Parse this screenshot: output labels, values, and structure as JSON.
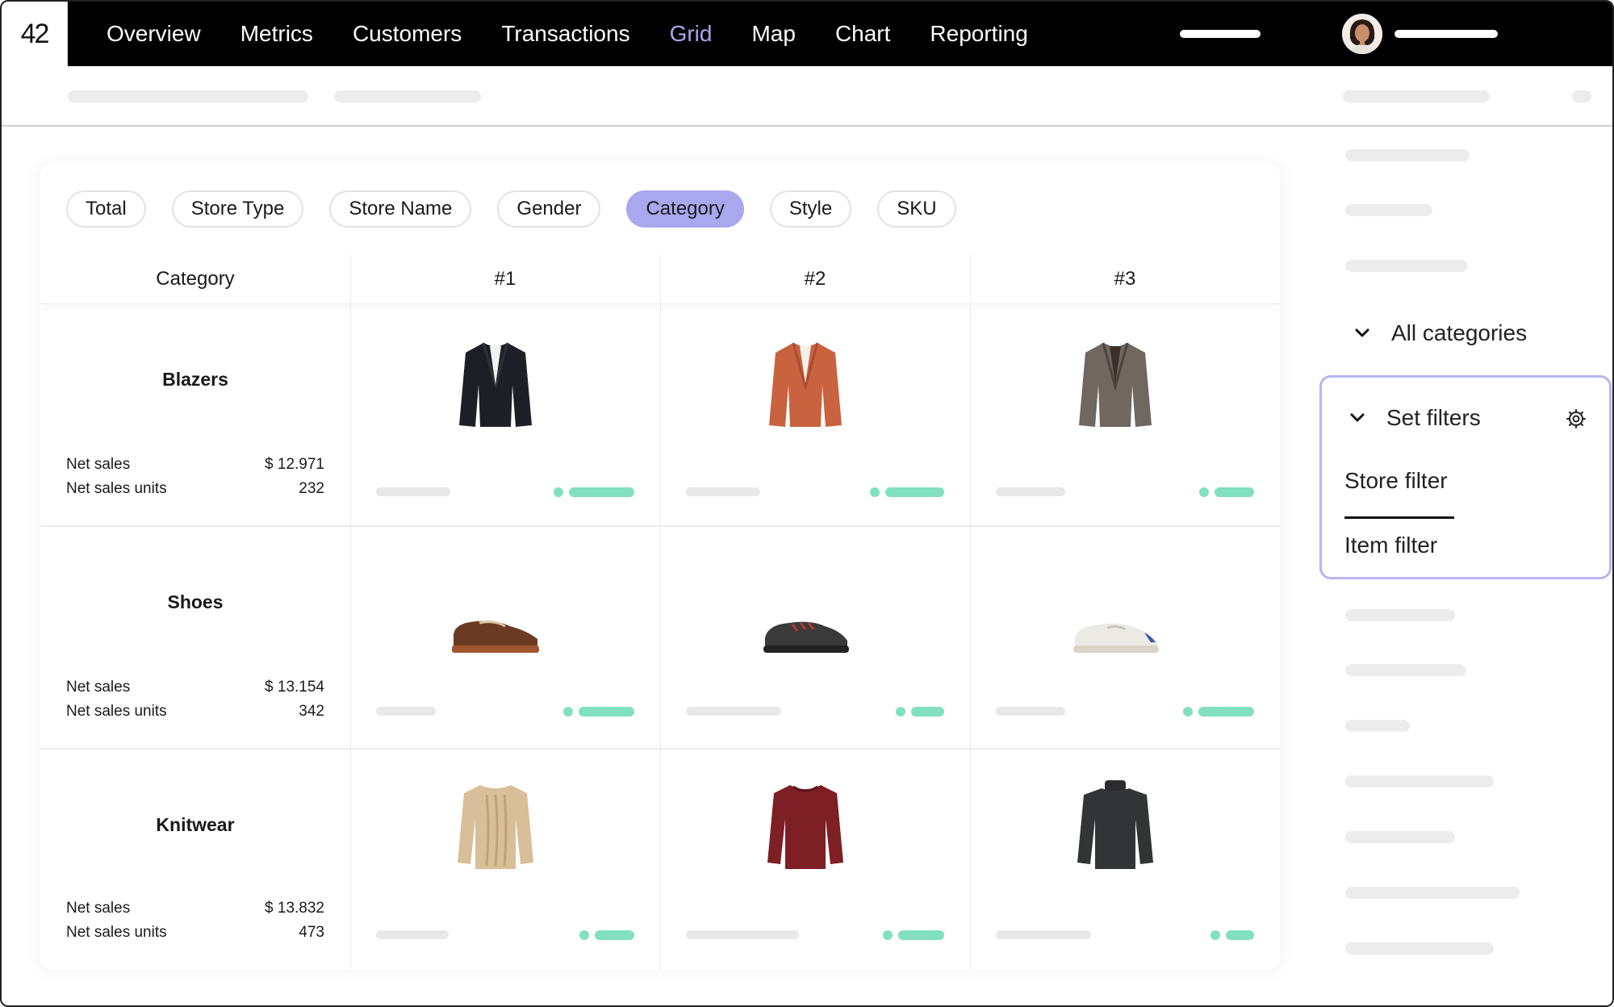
{
  "logo": "42",
  "nav": {
    "items": [
      {
        "label": "Overview",
        "active": false
      },
      {
        "label": "Metrics",
        "active": false
      },
      {
        "label": "Customers",
        "active": false
      },
      {
        "label": "Transactions",
        "active": false
      },
      {
        "label": "Grid",
        "active": true
      },
      {
        "label": "Map",
        "active": false
      },
      {
        "label": "Chart",
        "active": false
      },
      {
        "label": "Reporting",
        "active": false
      }
    ]
  },
  "tabs": [
    {
      "label": "Total",
      "active": false
    },
    {
      "label": "Store Type",
      "active": false
    },
    {
      "label": "Store Name",
      "active": false
    },
    {
      "label": "Gender",
      "active": false
    },
    {
      "label": "Category",
      "active": true
    },
    {
      "label": "Style",
      "active": false
    },
    {
      "label": "SKU",
      "active": false
    }
  ],
  "grid": {
    "headers": [
      "Category",
      "#1",
      "#2",
      "#3"
    ],
    "rows": [
      {
        "title": "Blazers",
        "net_sales_label": "Net sales",
        "net_sales": "$ 12.971",
        "units_label": "Net sales units",
        "units": "232",
        "products": [
          "dark-blazer-image",
          "rust-blazer-image",
          "grey-check-blazer-image"
        ]
      },
      {
        "title": "Shoes",
        "net_sales_label": "Net sales",
        "net_sales": "$ 13.154",
        "units_label": "Net sales units",
        "units": "342",
        "products": [
          "brown-boat-shoe-image",
          "dark-sneaker-image",
          "white-sneaker-image"
        ]
      },
      {
        "title": "Knitwear",
        "net_sales_label": "Net sales",
        "net_sales": "$ 13.832",
        "units_label": "Net sales units",
        "units": "473",
        "products": [
          "beige-cable-sweater-image",
          "burgundy-sweater-image",
          "charcoal-turtleneck-image"
        ]
      }
    ]
  },
  "right_panel": {
    "all_categories": "All categories",
    "set_filters": "Set filters",
    "store_filter": "Store filter",
    "item_filter": "Item filter"
  },
  "colors": {
    "accent": "#a9a7ee",
    "positive": "#80e0c0",
    "nav_bg": "#000000"
  }
}
